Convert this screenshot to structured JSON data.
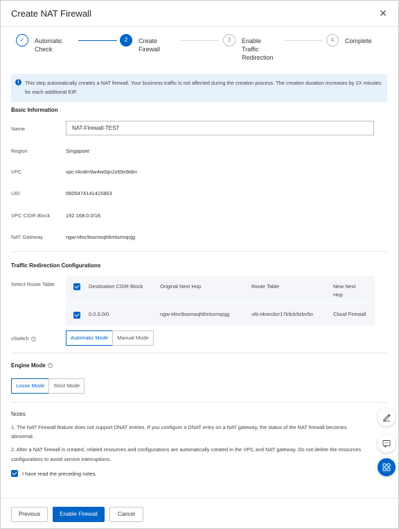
{
  "dialog": {
    "title": "Create NAT Firewall"
  },
  "steps": [
    {
      "label": "Automatic\nCheck",
      "number": "✓",
      "state": "done"
    },
    {
      "label": "Create\nFirewall",
      "number": "2",
      "state": "active"
    },
    {
      "label": "Enable\nTraffic\nRedirection",
      "number": "3",
      "state": "pending"
    },
    {
      "label": "Complete",
      "number": "4",
      "state": "pending"
    }
  ],
  "info": {
    "text": "This step automatically creates a NAT firewall. Your business traffic is not affected during the creation process. The creation duration increases by 2X minutes for each additional EIP."
  },
  "basic": {
    "title": "Basic Information",
    "name_label": "Name",
    "name_value": "NAT-Firewall-TEST",
    "region_label": "Region",
    "region_value": "Singapore",
    "vpc_label": "VPC",
    "vpc_value": "vpc-t4ndm9w4w0qn2z69x9idm",
    "uid_label": "UID",
    "uid_value": "5605474141415863",
    "cidr_label": "VPC CIDR Block",
    "cidr_value": "192.168.0.0/16",
    "natgw_label": "NAT Gateway",
    "natgw_value": "ngw-t4nc9oomxqh6mlurmqsjg"
  },
  "traffic": {
    "title": "Traffic Redirection Configurations",
    "route_table_label": "Select Route Table",
    "columns": [
      "Destination CIDR Block",
      "Original Next Hop",
      "Route Table",
      "New Next\nHop"
    ],
    "rows": [
      {
        "cidr": "0.0.0.0/0",
        "original": "ngw-t4nc9oomxqh6mlurmqsjg",
        "route_table": "vtb-t4nec8zr17kfick9zbv5o",
        "new_hop": "Cloud Firewall"
      }
    ],
    "vswitch_label": "vSwitch",
    "vswitch_help": "?",
    "vswitch_options": [
      "Automatic Mode",
      "Manual Mode"
    ]
  },
  "engine": {
    "title": "Engine Mode",
    "help": "?",
    "options": [
      "Loose Mode",
      "Strict Mode"
    ]
  },
  "notes": {
    "title": "Notes",
    "line1": "1. The NAT Firewall feature does not support DNAT entries. If you configure a DNAT entry on a NAT gateway, the status of the NAT firewall becomes",
    "line1b": "abnormal.",
    "line2": "2. After a NAT firewall is created, related resources and configurations are automatically created in the VPC and NAT gateway. Do not delete the resources",
    "line2b": "configurations to avoid service interruptions.",
    "agree": "I have read the preceding notes."
  },
  "footer": {
    "previous": "Previous",
    "enable": "Enable Firewall",
    "cancel": "Cancel"
  },
  "colors": {
    "accent": "#0064c8",
    "info_bg": "#e6f1fb",
    "table_bg": "#f4f6f9"
  },
  "icons": {
    "close": "close-icon",
    "info": "info-icon",
    "edit": "edit-icon",
    "chat": "chat-icon",
    "apps": "apps-icon"
  }
}
